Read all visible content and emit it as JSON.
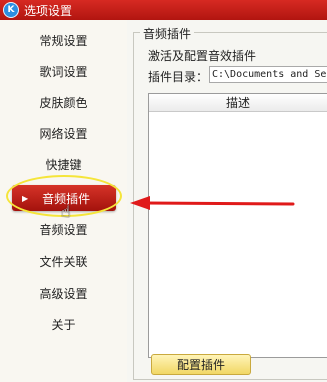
{
  "window": {
    "title": "选项设置"
  },
  "sidebar": {
    "items": [
      {
        "label": "常规设置",
        "active": false
      },
      {
        "label": "歌词设置",
        "active": false
      },
      {
        "label": "皮肤颜色",
        "active": false
      },
      {
        "label": "网络设置",
        "active": false
      },
      {
        "label": "快捷键",
        "active": false
      },
      {
        "label": "音频插件",
        "active": true
      },
      {
        "label": "音频设置",
        "active": false
      },
      {
        "label": "文件关联",
        "active": false
      },
      {
        "label": "高级设置",
        "active": false
      },
      {
        "label": "关于",
        "active": false
      }
    ]
  },
  "panel": {
    "group_title": "音频插件",
    "description": "激活及配置音效插件",
    "dir_label": "插件目录：",
    "dir_value": "C:\\Documents and Se",
    "list_header": "描述",
    "config_button": "配置插件"
  },
  "colors": {
    "accent": "#c41f18",
    "annotation_arrow": "#e01a1a",
    "annotation_ellipse": "#f5e53a",
    "button_fill": "#f1d765"
  },
  "icons": {
    "app": "k-logo-icon",
    "active_caret": "caret-right-icon",
    "cursor": "hand-cursor-icon",
    "annotation": "arrow-left-icon"
  }
}
